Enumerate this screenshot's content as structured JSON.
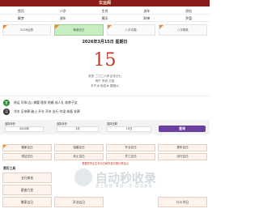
{
  "header": {
    "title": "玄运阁"
  },
  "nav": {
    "rows": [
      [
        "首页",
        "八字",
        "生肖",
        "流年",
        "测名"
      ],
      [
        "解梦",
        "流年",
        "黄历",
        "财神",
        "罗盘"
      ]
    ]
  },
  "tags": [
    {
      "label": "2026运势",
      "active": false
    },
    {
      "label": "黄道吉日",
      "active": true
    },
    {
      "label": "八字合婚",
      "active": false
    },
    {
      "label": "八字精批",
      "active": false
    }
  ],
  "date": {
    "headline": "2026年3月15日 星期日",
    "day": "15",
    "lunar": [
      "农历 二〇二六年正月廿七",
      "丙午 辛卯 己亥",
      "天干水 地支木 属相火"
    ]
  },
  "yi": {
    "badge": "宜",
    "text": "修运 司命(吉) 嫁娶 理发 结婚 成人礼 收养子女"
  },
  "ji": {
    "badge": "忌",
    "text": "伐木 至亲葬 破土 开仓 开市 出行 作梁 纳畜 安葬"
  },
  "query": {
    "year_label": "选择年份",
    "year_value": "2026年",
    "month_label": "选择月份",
    "month_value": "3月",
    "day_label": "选择日期",
    "day_value": "15日",
    "button": "查询"
  },
  "pills_row1": [
    "搬家吉日",
    "结婚吉日",
    "开业吉日",
    "提车吉日"
  ],
  "pills_row2": [
    "领证吉日",
    "动土吉日",
    "开工吉日",
    "出行吉日"
  ],
  "notice": "根据您的出生年月日和所选日期计算吉凶",
  "tools_label": "黄历工具",
  "tools": [
    [
      "五行穿衣",
      "",
      "",
      ""
    ],
    [
      "星座九宫",
      "",
      "",
      ""
    ],
    [
      "搬家吉日",
      "开业吉日",
      "",
      "什么节日"
    ]
  ],
  "watermark": {
    "title": "自动秒收录",
    "subtitle": "放上链接·来访一次·自动收录"
  }
}
